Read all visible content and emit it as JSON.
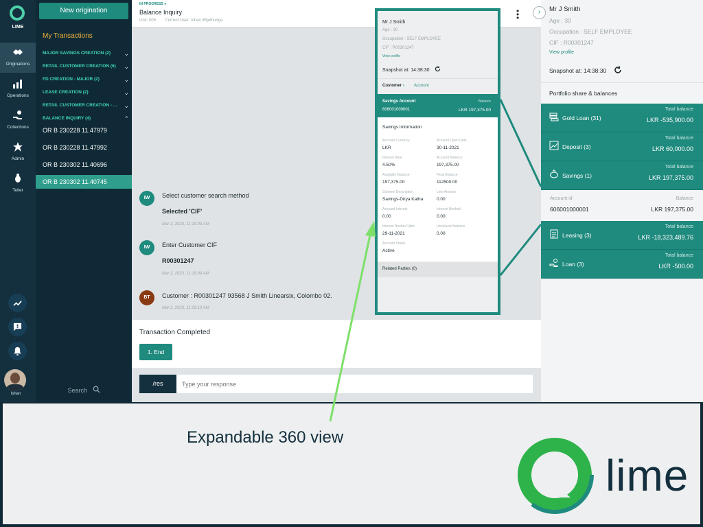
{
  "rail": {
    "brand": "LIME",
    "items": [
      {
        "label": "Originations",
        "icon": "handshake-icon"
      },
      {
        "label": "Operations",
        "icon": "bar-chart-icon"
      },
      {
        "label": "Collections",
        "icon": "hand-money-icon"
      },
      {
        "label": "Admin",
        "icon": "star-icon"
      },
      {
        "label": "Teller",
        "icon": "bug-icon"
      }
    ],
    "user": "Ishan"
  },
  "transactions": {
    "new_button": "New origination",
    "title": "My Transactions",
    "groups": [
      "MAJOR SAVINGS CREATION (2)",
      "RETAIL CUSTOMER CREATION (6)",
      "FD CREATION - MAJOR (2)",
      "LEASE CREATION (2)",
      "RETAIL CUSTOMER CREATION - ...",
      "BALANCE INQUIRY (4)"
    ],
    "items": [
      "OR B 230228 11.47979",
      "OR B 230228 11.47992",
      "OR B 230302 11.40696",
      "OR B 230302 11.40745"
    ],
    "search": "Search"
  },
  "chat": {
    "status": "IN PROGRESS",
    "title": "Balance Inquiry",
    "unit": "Unit: 005",
    "current_user": "Current User: Ishan Wijethunga",
    "messages": [
      {
        "avatar": "IW",
        "text": "Select customer search method",
        "bold": "Selected 'CIF'",
        "date": "Mar 2, 2023, 11:19:09 AM"
      },
      {
        "avatar": "IW",
        "text": "Enter Customer CIF",
        "bold": "R00301247",
        "date": "Mar 2, 2023, 11:19:09 AM"
      },
      {
        "avatar": "BT",
        "text": "Customer : R00301247 93568 J Smith Linearsix, Colombo 02.",
        "date": "Mar 2, 2023, 11:19:10 AM"
      }
    ],
    "completed": "Transaction Completed",
    "end_button": "1. End",
    "res_tag": "/res",
    "res_placeholder": "Type your response"
  },
  "customer": {
    "name": "Mr J Smith",
    "age": "Age : 30",
    "occupation": "Occupation : SELF EMPLOYEE",
    "cif": "CIF : R00301247",
    "view_profile": "View profile",
    "snapshot": "Snapshot at: 14:38:30",
    "portfolio_title": "Portfolio share & balances",
    "total_balance_label": "Total balance",
    "portfolio": [
      {
        "name": "Gold Loan (31)",
        "value": "LKR -535,900.00"
      },
      {
        "name": "Deposit (3)",
        "value": "LKR 60,000.00"
      },
      {
        "name": "Savings (1)",
        "value": "LKR 197,375.00"
      },
      {
        "name": "Leasing (3)",
        "value": "LKR -18,323,489.76"
      },
      {
        "name": "Loan (3)",
        "value": "LKR -500.00"
      }
    ],
    "account": {
      "id_label": "Account id",
      "id": "606001000001",
      "balance_label": "Balance",
      "balance": "LKR 197,375.00"
    }
  },
  "overlay": {
    "breadcrumb_1": "Customer",
    "breadcrumb_2": "Account",
    "savings_title": "Savings Account",
    "savings_number": "606001000001",
    "balance_label": "Balance",
    "balance": "LKR 197,375.00",
    "info_title": "Savings Information",
    "fields": [
      {
        "k": "Account Currency",
        "v": "LKR"
      },
      {
        "k": "Account Open Date",
        "v": "30-11-2021"
      },
      {
        "k": "Interest Rate",
        "v": "4.50%"
      },
      {
        "k": "Account Balance",
        "v": "197,375.00"
      },
      {
        "k": "Available Balance",
        "v": "197,375.00"
      },
      {
        "k": "Float Balance",
        "v": "112500.00"
      },
      {
        "k": "Scheme Description",
        "v": "Savings-Dirya Katha"
      },
      {
        "k": "Lien Amount",
        "v": "0.00"
      },
      {
        "k": "Accrued Interest",
        "v": "0.00"
      },
      {
        "k": "Interest Booked",
        "v": "0.00"
      },
      {
        "k": "Interest Booked Upto",
        "v": "29-11-2021"
      },
      {
        "k": "Uncleared balance",
        "v": "0.00"
      },
      {
        "k": "Account Status",
        "v": "Active"
      }
    ],
    "related": "Related Parties (0)"
  },
  "footer": {
    "caption": "Expandable 360 view",
    "logo_text": "lime"
  },
  "colors": {
    "accent": "#1f8a7e",
    "dark": "#0f2a36",
    "highlight": "#3fd6b6",
    "gold": "#f2b13b",
    "arrow": "#7ee06a"
  }
}
